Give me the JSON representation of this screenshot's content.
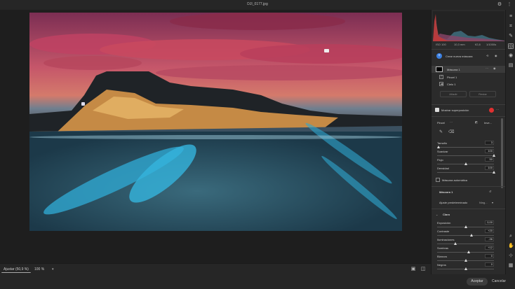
{
  "title": "DJI_0177.jpg",
  "meta": {
    "iso": "ISO 100",
    "focal": "10,3 mm",
    "aperture": "f/2,8",
    "shutter": "1/1000s"
  },
  "masks": {
    "create_label": "Crear nueva máscara",
    "mask_name": "Máscara 1",
    "items": [
      "Pincel 1",
      "Cielo 1"
    ],
    "add": "Añadir",
    "subtract": "Restar"
  },
  "overlay": {
    "label": "Mostrar superposición",
    "color": "#e03030"
  },
  "brush": {
    "label": "Pincel",
    "invert": "Inve...",
    "sliders": [
      {
        "label": "Tamaño",
        "value": "3",
        "pos": 0.02
      },
      {
        "label": "Suavizar",
        "value": "100",
        "pos": 1.0
      },
      {
        "label": "Flujo",
        "value": "50",
        "pos": 0.5
      },
      {
        "label": "Densidad",
        "value": "100",
        "pos": 1.0
      }
    ],
    "automask": "Máscara automática"
  },
  "mask_section": {
    "title": "Máscara 1",
    "preset_label": "Ajuste predeterminado",
    "preset_value": "Ning..."
  },
  "light": {
    "title": "Claro",
    "sliders": [
      {
        "label": "Exposición",
        "value": "0,00",
        "pos": 0.5
      },
      {
        "label": "Contraste",
        "value": "+20",
        "pos": 0.6
      },
      {
        "label": "Iluminaciones",
        "value": "-36",
        "pos": 0.32
      },
      {
        "label": "Sombras",
        "value": "+12",
        "pos": 0.56
      },
      {
        "label": "Blancos",
        "value": "0",
        "pos": 0.5
      },
      {
        "label": "Negros",
        "value": "0",
        "pos": 0.5
      }
    ]
  },
  "bottom": {
    "fit": "Ajustar (50,9 %)",
    "zoom": "100 %"
  },
  "footer": {
    "accept": "Aceptar",
    "cancel": "Cancelar"
  }
}
